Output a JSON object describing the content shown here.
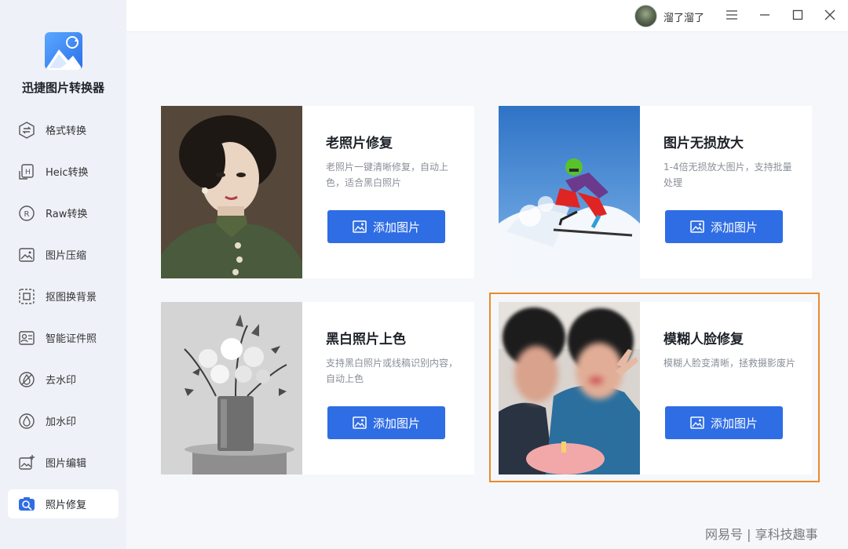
{
  "app": {
    "name": "迅捷图片转换器"
  },
  "user": {
    "name": "溜了溜了"
  },
  "sidebar": {
    "items": [
      {
        "label": "格式转换",
        "icon": "format-convert-icon"
      },
      {
        "label": "Heic转换",
        "icon": "heic-icon"
      },
      {
        "label": "Raw转换",
        "icon": "raw-icon"
      },
      {
        "label": "图片压缩",
        "icon": "compress-icon"
      },
      {
        "label": "抠图换背景",
        "icon": "cutout-icon"
      },
      {
        "label": "智能证件照",
        "icon": "id-photo-icon"
      },
      {
        "label": "去水印",
        "icon": "remove-watermark-icon"
      },
      {
        "label": "加水印",
        "icon": "add-watermark-icon"
      },
      {
        "label": "图片编辑",
        "icon": "edit-image-icon"
      },
      {
        "label": "照片修复",
        "icon": "photo-repair-icon",
        "active": true
      }
    ]
  },
  "cards": [
    {
      "title": "老照片修复",
      "desc": "老照片一键清晰修复，自动上色，适合黑白照片",
      "button": "添加图片"
    },
    {
      "title": "图片无损放大",
      "desc": "1-4倍无损放大图片，支持批量处理",
      "button": "添加图片"
    },
    {
      "title": "黑白照片上色",
      "desc": "支持黑白照片或线稿识别内容，自动上色",
      "button": "添加图片"
    },
    {
      "title": "模糊人脸修复",
      "desc": "模糊人脸变清晰，拯救摄影废片",
      "button": "添加图片",
      "highlighted": true
    }
  ],
  "colors": {
    "accent": "#2f6de5",
    "highlight_border": "#e98a2d",
    "sidebar_bg": "#eef1f8"
  },
  "watermark": "网易号 | 享科技趣事"
}
